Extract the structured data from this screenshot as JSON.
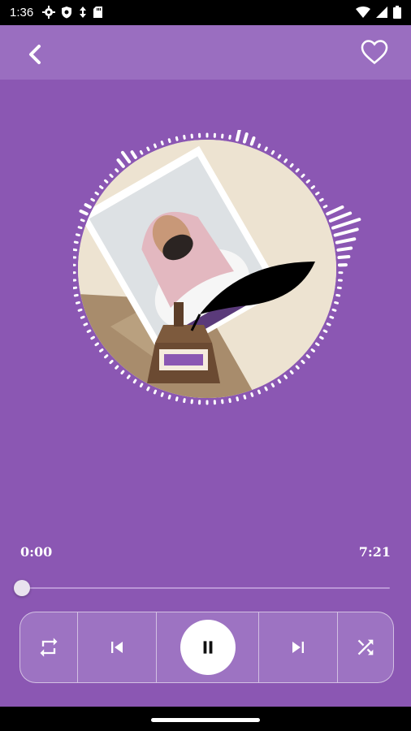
{
  "status_bar": {
    "time": "1:36",
    "left_icons": [
      "settings-icon",
      "shield-icon",
      "data-saver-icon",
      "sd-card-icon"
    ],
    "right_icons": [
      "wifi-icon",
      "signal-icon",
      "battery-icon"
    ]
  },
  "app_bar": {
    "back_icon": "chevron-left-icon",
    "favorite_icon": "heart-outline-icon"
  },
  "player": {
    "elapsed": "0:00",
    "duration": "7:21",
    "progress": 0.0,
    "is_playing": true
  },
  "controls": [
    {
      "name": "repeat",
      "icon": "repeat-icon"
    },
    {
      "name": "previous",
      "icon": "skip-previous-icon"
    },
    {
      "name": "play-pause",
      "icon": "pause-icon"
    },
    {
      "name": "next",
      "icon": "skip-next-icon"
    },
    {
      "name": "shuffle",
      "icon": "shuffle-icon"
    }
  ],
  "colors": {
    "background": "#8B57B3",
    "app_bar": "#9A6EC0",
    "accent": "#FFFFFF"
  }
}
